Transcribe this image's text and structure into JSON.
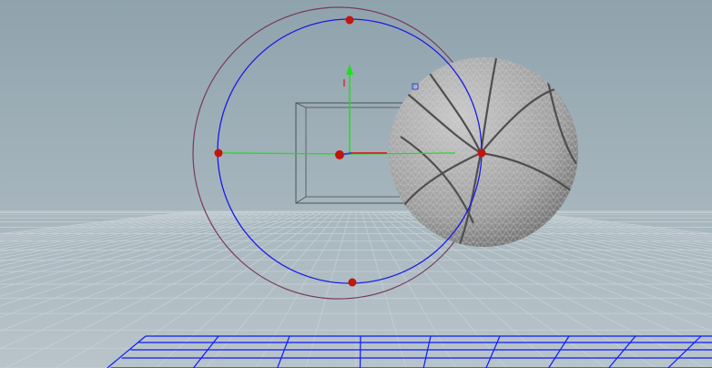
{
  "viewport": {
    "label": "",
    "colors": {
      "background_top": "#8fa3ad",
      "background_bottom": "#b9c4ca",
      "ground_grid": "#c6d0d5",
      "construction_plane_grid": "#0b1bff",
      "outer_rotate_ring": "#7a3a5e",
      "inner_rotate_ring": "#1a1ae6",
      "handle_dot": "#c0160c",
      "axis_x": "#d23030",
      "axis_y": "#22dd22",
      "axis_z": "#2d4bd8",
      "mesh_fill": "#a9a9a9",
      "mesh_wire": "#d6d6d6",
      "mesh_seam": "#4f4f4f",
      "bbox_stroke": "#4a5258"
    },
    "icons": {
      "rotate_handle": "circle-handle-icon",
      "translate_handle": "arrow-handle-icon"
    }
  }
}
